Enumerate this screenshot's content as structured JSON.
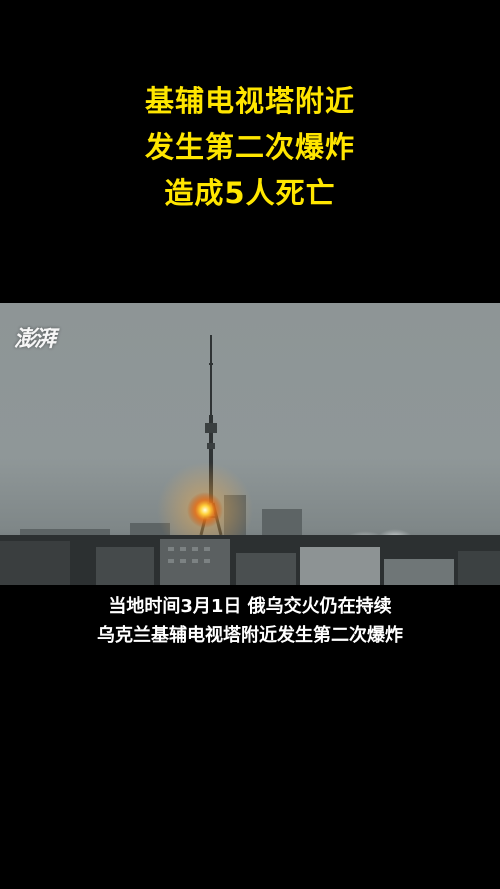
{
  "headline": {
    "line1": "基辅电视塔附近",
    "line2": "发生第二次爆炸",
    "line3": "造成5人死亡"
  },
  "video": {
    "watermark": "澎湃",
    "scene": "tv-tower-explosion"
  },
  "captions": {
    "line1": "当地时间3月1日 俄乌交火仍在持续",
    "line2": "乌克兰基辅电视塔附近发生第二次爆炸"
  },
  "colors": {
    "background": "#000000",
    "headline": "#ffe600",
    "caption": "#ffffff"
  }
}
